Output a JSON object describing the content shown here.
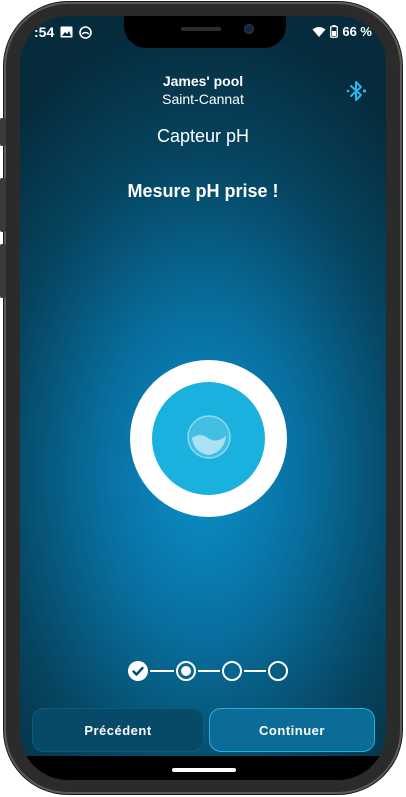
{
  "status_bar": {
    "time": ":54",
    "battery": "66 %"
  },
  "header": {
    "pool_name": "James' pool",
    "location": "Saint-Cannat"
  },
  "page": {
    "title": "Capteur pH",
    "message": "Mesure pH prise !"
  },
  "stepper": {
    "total_steps": 4,
    "current_step": 2
  },
  "buttons": {
    "previous": "Précédent",
    "next": "Continuer"
  },
  "colors": {
    "accent": "#1ab1de",
    "bluetooth": "#2cb5f0",
    "button_next_border": "#29aee0"
  },
  "icons": {
    "bluetooth": "bluetooth-icon",
    "water": "water-drop-icon",
    "check": "check-icon",
    "wifi": "wifi-icon",
    "battery": "battery-icon"
  }
}
